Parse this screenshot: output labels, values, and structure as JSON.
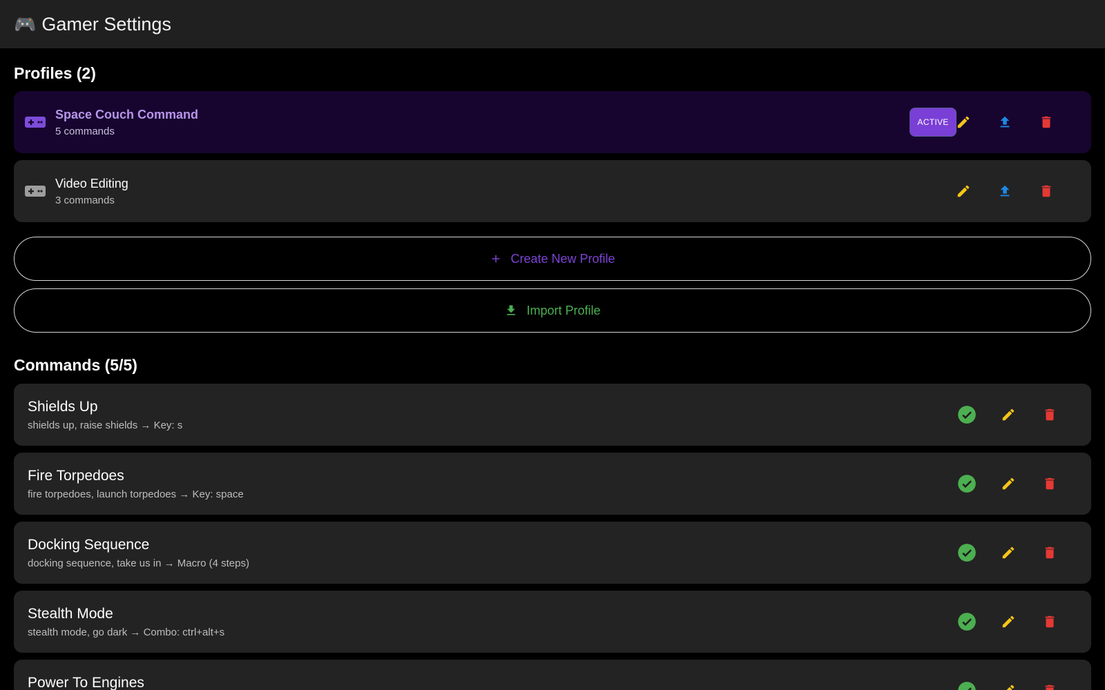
{
  "header": {
    "emoji": "🎮",
    "title": "Gamer Settings"
  },
  "profiles": {
    "heading": "Profiles (2)",
    "items": [
      {
        "name": "Space Couch Command",
        "count": "5 commands",
        "active": true,
        "badge": "ACTIVE"
      },
      {
        "name": "Video Editing",
        "count": "3 commands",
        "active": false
      }
    ],
    "create_label": "Create New Profile",
    "import_label": "Import Profile"
  },
  "commands": {
    "heading": "Commands (5/5)",
    "items": [
      {
        "name": "Shields Up",
        "desc": "shields up, raise shields → Key: s"
      },
      {
        "name": "Fire Torpedoes",
        "desc": "fire torpedoes, launch torpedoes → Key: space"
      },
      {
        "name": "Docking Sequence",
        "desc": "docking sequence, take us in → Macro (4 steps)"
      },
      {
        "name": "Stealth Mode",
        "desc": "stealth mode, go dark → Combo: ctrl+alt+s"
      },
      {
        "name": "Power To Engines",
        "desc": ""
      }
    ]
  },
  "colors": {
    "accent_purple": "#7a3fd6",
    "edit_yellow": "#f5c518",
    "export_blue": "#1e88e5",
    "delete_red": "#e53935",
    "enabled_green": "#4caf50"
  },
  "icons": {
    "gamepad": "gamepad-icon",
    "edit": "pencil-icon",
    "export": "upload-icon",
    "delete": "trash-icon",
    "enabled": "check-circle-icon",
    "add": "plus-icon",
    "import": "download-icon"
  }
}
